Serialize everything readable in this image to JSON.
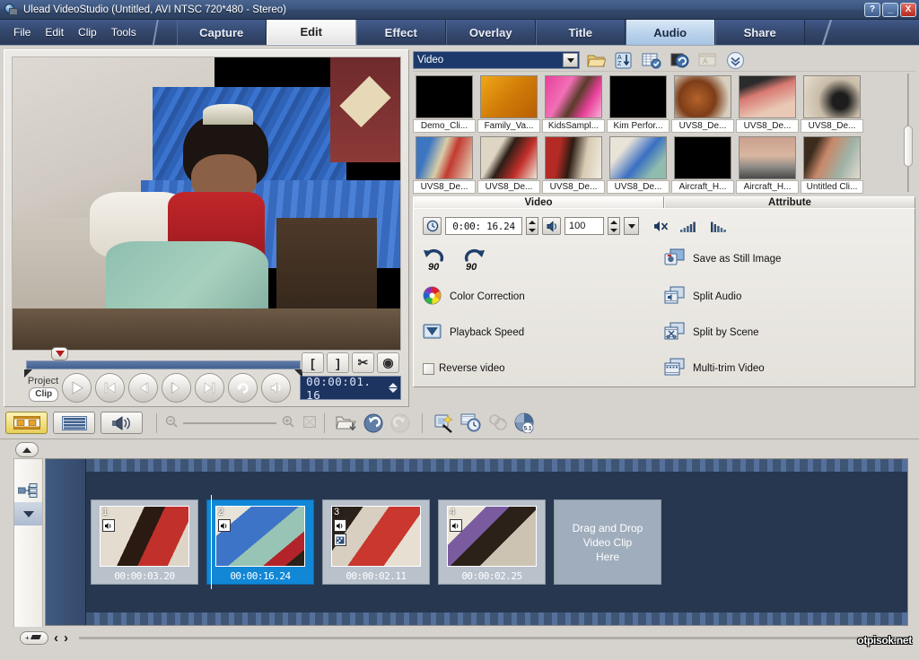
{
  "window": {
    "title": "Ulead VideoStudio (Untitled, AVI NTSC 720*480 - Stereo)",
    "help_label": "?",
    "minimize_label": "_",
    "close_label": "X"
  },
  "menu": {
    "items": [
      {
        "label": "File"
      },
      {
        "label": "Edit"
      },
      {
        "label": "Clip"
      },
      {
        "label": "Tools"
      }
    ]
  },
  "step_tabs": [
    {
      "label": "Capture",
      "state": "normal"
    },
    {
      "label": "Edit",
      "state": "active"
    },
    {
      "label": "Effect",
      "state": "normal"
    },
    {
      "label": "Overlay",
      "state": "normal"
    },
    {
      "label": "Title",
      "state": "normal"
    },
    {
      "label": "Audio",
      "state": "highlight"
    },
    {
      "label": "Share",
      "state": "normal"
    }
  ],
  "preview": {
    "trim_buttons": [
      {
        "label": "[",
        "name": "mark-in-button"
      },
      {
        "label": "]",
        "name": "mark-out-button"
      },
      {
        "label": "✂",
        "name": "cut-clip-button"
      },
      {
        "label": "◉",
        "name": "enlarge-preview-button"
      }
    ],
    "mode_project_label": "Project",
    "mode_clip_label": "Clip",
    "transport": [
      {
        "name": "play-button",
        "icon": "play"
      },
      {
        "name": "home-button",
        "icon": "home"
      },
      {
        "name": "previous-frame-button",
        "icon": "prev-frame"
      },
      {
        "name": "next-frame-button",
        "icon": "next-frame"
      },
      {
        "name": "end-button",
        "icon": "end"
      },
      {
        "name": "repeat-button",
        "icon": "repeat"
      },
      {
        "name": "volume-button",
        "icon": "volume"
      }
    ],
    "timecode": "00:00:01. 16"
  },
  "library": {
    "category": "Video",
    "toolbar_icons": [
      {
        "name": "load-video-icon",
        "title": "Load Video"
      },
      {
        "name": "sort-az-icon",
        "title": "Sort by Name"
      },
      {
        "name": "library-options-icon",
        "title": "Library Options"
      },
      {
        "name": "reset-icon",
        "title": "Reset"
      },
      {
        "name": "add-folder-icon",
        "title": "Add Folder"
      },
      {
        "name": "expand-chevron-icon",
        "title": "Expand"
      }
    ],
    "items": [
      {
        "caption": "Demo_Cli...",
        "kind": "black"
      },
      {
        "caption": "Family_Va...",
        "kind": "gold"
      },
      {
        "caption": "KidsSampl...",
        "kind": "pink"
      },
      {
        "caption": "Kim Perfor...",
        "kind": "black"
      },
      {
        "caption": "UVS8_De...",
        "kind": "party1"
      },
      {
        "caption": "UVS8_De...",
        "kind": "cake1"
      },
      {
        "caption": "UVS8_De...",
        "kind": "party2"
      },
      {
        "caption": "UVS8_De...",
        "kind": "room1"
      },
      {
        "caption": "UVS8_De...",
        "kind": "girl1"
      },
      {
        "caption": "UVS8_De...",
        "kind": "girl2"
      },
      {
        "caption": "UVS8_De...",
        "kind": "bed1"
      },
      {
        "caption": "Aircraft_H...",
        "kind": "black"
      },
      {
        "caption": "Aircraft_H...",
        "kind": "sky"
      },
      {
        "caption": "Untitled Cli...",
        "kind": "man"
      }
    ]
  },
  "options": {
    "tabs": [
      {
        "label": "Video",
        "active": true
      },
      {
        "label": "Attribute",
        "active": false
      }
    ],
    "duration": "0:00: 16.24",
    "volume": "100",
    "audio_icons": [
      {
        "name": "mute-icon"
      },
      {
        "name": "fade-in-icon"
      },
      {
        "name": "fade-out-icon"
      }
    ],
    "rotate_left_label": "90",
    "rotate_right_label": "90",
    "left_column": [
      {
        "label": "Color Correction",
        "icon": "color-wheel-icon"
      },
      {
        "label": "Playback Speed",
        "icon": "playback-speed-icon"
      },
      {
        "label": "Reverse video",
        "icon": "checkbox"
      }
    ],
    "right_column": [
      {
        "label": "Save as Still Image",
        "icon": "still-image-icon"
      },
      {
        "label": "Split Audio",
        "icon": "split-audio-icon"
      },
      {
        "label": "Split by Scene",
        "icon": "split-scene-icon"
      },
      {
        "label": "Multi-trim Video",
        "icon": "multi-trim-icon"
      }
    ]
  },
  "timeline_toolbar": {
    "view_modes": [
      {
        "name": "storyboard-view-button",
        "icon": "storyboard",
        "active": true
      },
      {
        "name": "timeline-view-button",
        "icon": "timeline",
        "active": false
      },
      {
        "name": "audio-view-button",
        "icon": "audio",
        "active": false
      }
    ],
    "zoom_out_label": "−",
    "zoom_in_label": "+",
    "fit_label": "⌧",
    "tools": [
      {
        "name": "insert-media-icon"
      },
      {
        "name": "undo-icon"
      },
      {
        "name": "redo-icon"
      },
      {
        "name": "smart-package-icon"
      },
      {
        "name": "batch-convert-icon"
      },
      {
        "name": "audio-mixer-icon"
      },
      {
        "name": "surround-51-icon",
        "label": "5.1"
      }
    ]
  },
  "timeline": {
    "track_toggle_label": "+ / −",
    "clips": [
      {
        "number": "1",
        "duration": "00:00:03.20",
        "selected": false,
        "badges": [
          "audio"
        ],
        "kind": "girl-eating"
      },
      {
        "number": "2",
        "duration": "00:00:16.24",
        "selected": true,
        "badges": [
          "audio"
        ],
        "kind": "girl-bed"
      },
      {
        "number": "3",
        "duration": "00:00:02.11",
        "selected": false,
        "badges": [
          "audio",
          "effect"
        ],
        "kind": "cake"
      },
      {
        "number": "4",
        "duration": "00:00:02.25",
        "selected": false,
        "badges": [
          "audio"
        ],
        "kind": "table"
      }
    ],
    "dropzone_label": "Drag and Drop\nVideo Clip\nHere",
    "dropzone_lines": [
      "Drag and Drop",
      "Video Clip",
      "Here"
    ],
    "nav_prev_label": "‹",
    "nav_next_label": "›"
  },
  "watermark": "otpisok.net",
  "colors": {
    "titlebar": "#3c567f",
    "accent_blue": "#1187d6",
    "panel_bg": "#d6d3ce",
    "timeline_bg": "#27374f",
    "active_tab": "#f1f1f1",
    "highlight_tab": "#bcd4ec"
  }
}
